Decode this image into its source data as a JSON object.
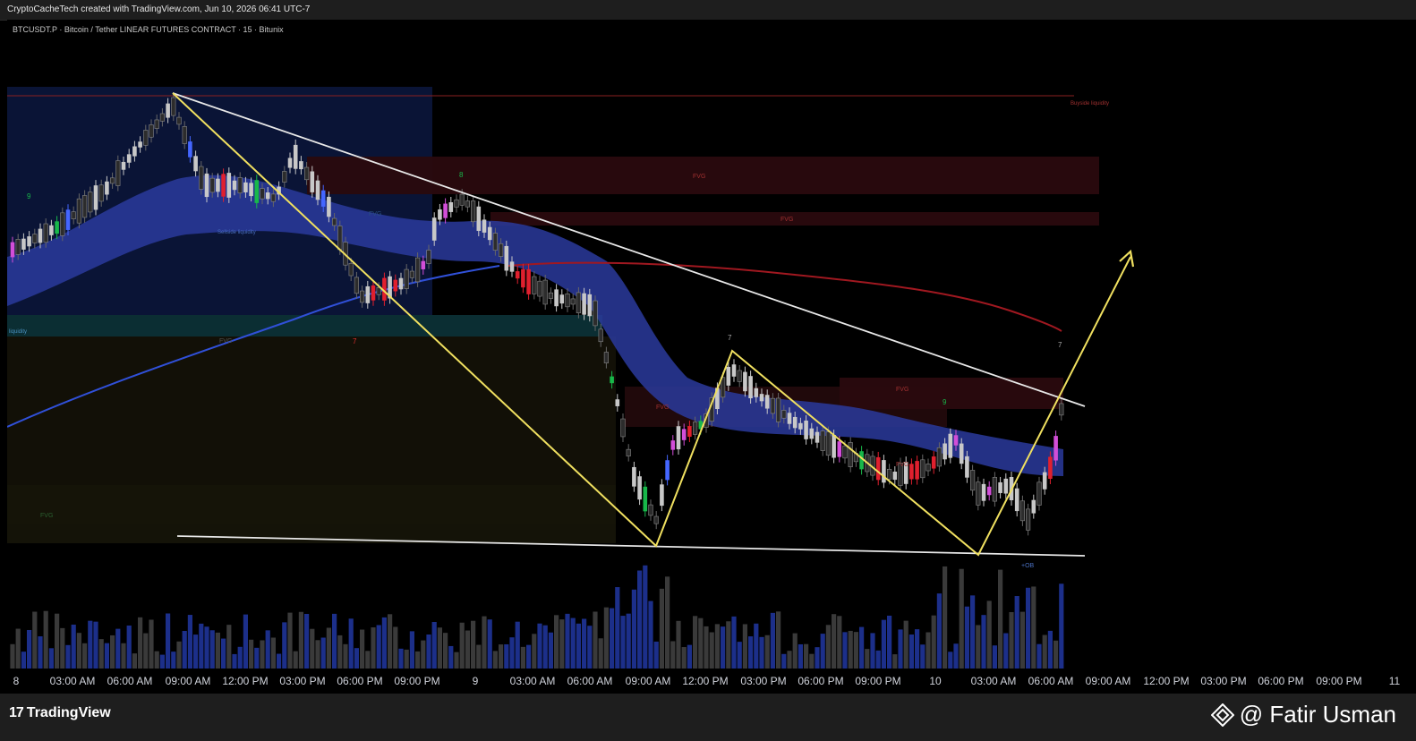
{
  "header": {
    "watermark_text": "CryptoCacheTech created with TradingView.com, Jun 10, 2026 06:41 UTC-7",
    "symbol_line": "BTCUSDT.P · Bitcoin / Tether LINEAR FUTURES CONTRACT · 15 · Bitunix"
  },
  "time_axis": {
    "labels": [
      "8",
      "03:00 AM",
      "06:00 AM",
      "09:00 AM",
      "12:00 PM",
      "03:00 PM",
      "06:00 PM",
      "09:00 PM",
      "9",
      "03:00 AM",
      "06:00 AM",
      "09:00 AM",
      "12:00 PM",
      "03:00 PM",
      "06:00 PM",
      "09:00 PM",
      "10",
      "03:00 AM",
      "06:00 AM",
      "09:00 AM",
      "12:00 PM",
      "03:00 PM",
      "06:00 PM",
      "09:00 PM",
      "11"
    ]
  },
  "annotations": {
    "fvg": "FVG",
    "buyside_liquidity": "Buyside liquidity",
    "sellside_liquidity": "Sellside liquidity",
    "liquidity": "liquidity",
    "ob": "+OB",
    "marker_7": "7",
    "marker_8": "8",
    "marker_9": "9"
  },
  "footer": {
    "brand": "TradingView",
    "brand_mark": "17",
    "author": "@ Fatir Usman"
  },
  "colors": {
    "bull": "#c8c8c8",
    "bear": "#3a3a3a",
    "red_candle": "#e0202e",
    "green_candle": "#18b84a",
    "magenta_candle": "#d24ed8",
    "blue_candle": "#4466ff",
    "ema_band": "#2a3a9c",
    "ma_blue": "#3050d8",
    "ma_red": "#a01820",
    "yellow_line": "#f0e060",
    "white_line": "#e8e8e8"
  }
}
